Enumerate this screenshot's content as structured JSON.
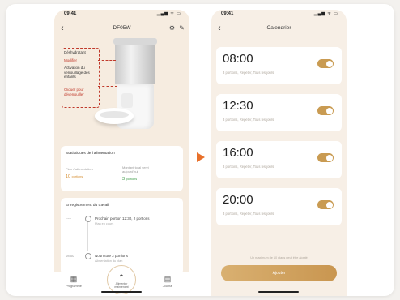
{
  "left_screen": {
    "status_time": "09:41",
    "status_icons": "▂▄▆ ᯤ ▭",
    "device_name": "DF05W",
    "feeder_callouts": {
      "desiccant": "Déshydratant",
      "desiccant_sub": "Modifier",
      "child_lock": "Activation du verrouillage des enfants",
      "child_lock_sub": "Cliquer pour déverrouiller"
    },
    "stats": {
      "title": "Statistiques de l'alimentation",
      "plan_label": "Plan d'alimentation",
      "plan_value": "10",
      "plan_unit": "portions",
      "total_label": "Montant total servi aujourd'hui",
      "total_value": "3",
      "total_unit": "portions"
    },
    "log": {
      "title": "Enregistrement du travail",
      "rows": [
        {
          "time": "-----",
          "text": "Prochain portion 12:30, 2 portions",
          "sub": "Plan en cours"
        },
        {
          "time": "08:00",
          "text": "Nourriture 2 portions",
          "sub": "Alimentation du plan"
        }
      ]
    },
    "tabs": {
      "left": "Programme",
      "center": "Alimenter maintenant",
      "right": "Journal"
    }
  },
  "right_screen": {
    "status_time": "09:41",
    "status_icons": "▂▄▆ ᯤ ▭",
    "title": "Calendrier",
    "schedules": [
      {
        "time": "08:00",
        "detail": "3 portions, Répéter, Tous les jours",
        "enabled": true
      },
      {
        "time": "12:30",
        "detail": "3 portions, Répéter, Tous les jours",
        "enabled": true
      },
      {
        "time": "16:00",
        "detail": "3 portions, Répéter, Tous les jours",
        "enabled": true
      },
      {
        "time": "20:00",
        "detail": "3 portions, Répéter, Tous les jours",
        "enabled": true
      }
    ],
    "footer_note": "Un maximum de 10 plans peut être ajouté",
    "add_button": "Ajouter"
  },
  "colors": {
    "accent": "#c99b52",
    "arrow": "#e8702a",
    "plan_value": "#d48a2a",
    "total_value": "#3a9a45"
  },
  "icons": {
    "back": "chevron-left-icon",
    "settings": "gear-icon",
    "edit": "edit-icon",
    "transition": "arrow-right-icon"
  }
}
